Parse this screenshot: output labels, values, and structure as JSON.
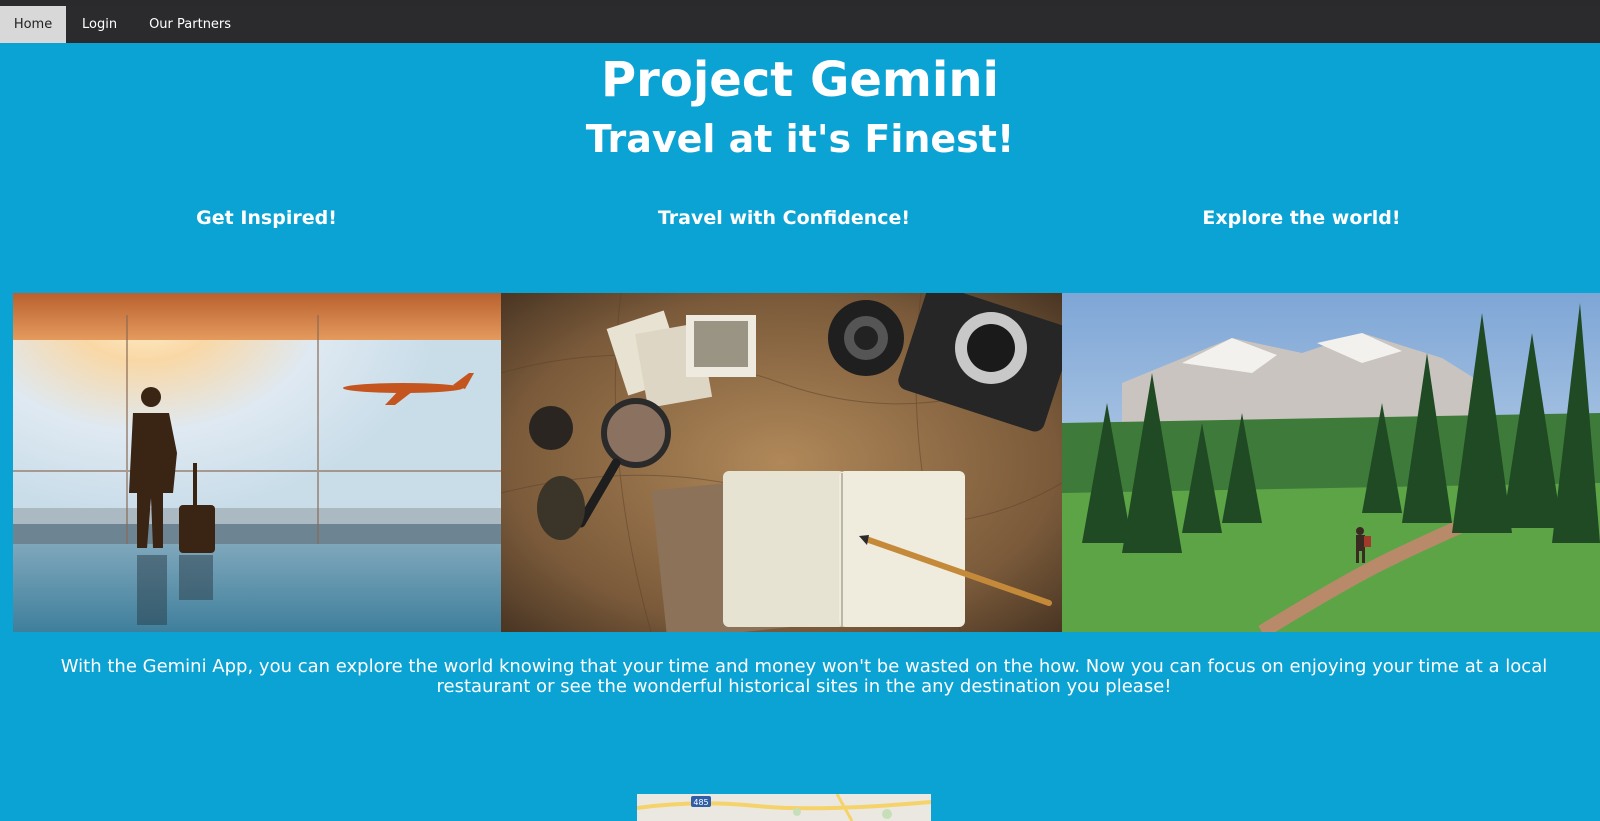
{
  "nav": {
    "items": [
      {
        "label": "Home",
        "active": true
      },
      {
        "label": "Login",
        "active": false
      },
      {
        "label": "Our Partners",
        "active": false
      }
    ]
  },
  "hero": {
    "title": "Project Gemini",
    "subtitle": "Travel at it's Finest!"
  },
  "columns": [
    {
      "heading": "Get Inspired!"
    },
    {
      "heading": "Travel with Confidence!"
    },
    {
      "heading": "Explore the world!"
    }
  ],
  "images": [
    {
      "name": "airport-traveler-photo"
    },
    {
      "name": "travel-gear-map-photo"
    },
    {
      "name": "mountain-forest-hiker-photo"
    }
  ],
  "description": "With the Gemini App, you can explore the world knowing that your time and money won't be wasted on the how. Now you can focus on enjoying your time at a local restaurant or see the wonderful historical sites in the any destination you please!",
  "map": {
    "route_label": "485"
  },
  "colors": {
    "background": "#0ba2d4",
    "navbar": "#2b2a2d",
    "nav_active": "#d8d8d8"
  }
}
